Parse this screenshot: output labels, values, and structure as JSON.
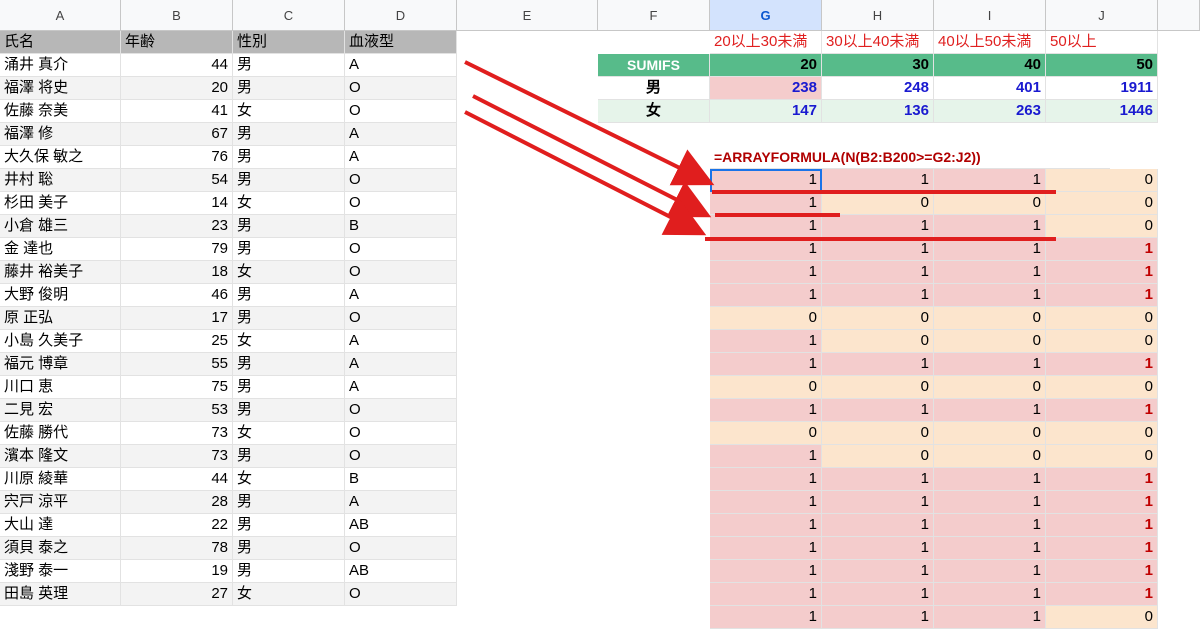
{
  "columns": [
    "A",
    "B",
    "C",
    "D",
    "E",
    "F",
    "G",
    "H",
    "I",
    "J"
  ],
  "selected_column": "G",
  "table_headers": {
    "name": "氏名",
    "age": "年齢",
    "gender": "性別",
    "blood": "血液型"
  },
  "people": [
    {
      "name": "涌井 真介",
      "age": "44",
      "gender": "男",
      "blood": "A"
    },
    {
      "name": "福澤 将史",
      "age": "20",
      "gender": "男",
      "blood": "O"
    },
    {
      "name": "佐藤 奈美",
      "age": "41",
      "gender": "女",
      "blood": "O"
    },
    {
      "name": "福澤 修",
      "age": "67",
      "gender": "男",
      "blood": "A"
    },
    {
      "name": "大久保 敏之",
      "age": "76",
      "gender": "男",
      "blood": "A"
    },
    {
      "name": "井村 聡",
      "age": "54",
      "gender": "男",
      "blood": "O"
    },
    {
      "name": "杉田 美子",
      "age": "14",
      "gender": "女",
      "blood": "O"
    },
    {
      "name": "小倉 雄三",
      "age": "23",
      "gender": "男",
      "blood": "B"
    },
    {
      "name": "金 達也",
      "age": "79",
      "gender": "男",
      "blood": "O"
    },
    {
      "name": "藤井 裕美子",
      "age": "18",
      "gender": "女",
      "blood": "O"
    },
    {
      "name": "大野 俊明",
      "age": "46",
      "gender": "男",
      "blood": "A"
    },
    {
      "name": "原 正弘",
      "age": "17",
      "gender": "男",
      "blood": "O"
    },
    {
      "name": "小島 久美子",
      "age": "25",
      "gender": "女",
      "blood": "A"
    },
    {
      "name": "福元 博章",
      "age": "55",
      "gender": "男",
      "blood": "A"
    },
    {
      "name": "川口 恵",
      "age": "75",
      "gender": "男",
      "blood": "A"
    },
    {
      "name": "二見 宏",
      "age": "53",
      "gender": "男",
      "blood": "O"
    },
    {
      "name": "佐藤 勝代",
      "age": "73",
      "gender": "女",
      "blood": "O"
    },
    {
      "name": "濱本 隆文",
      "age": "73",
      "gender": "男",
      "blood": "O"
    },
    {
      "name": "川原 綾華",
      "age": "44",
      "gender": "女",
      "blood": "B"
    },
    {
      "name": "宍戸 涼平",
      "age": "28",
      "gender": "男",
      "blood": "A"
    },
    {
      "name": "大山 達",
      "age": "22",
      "gender": "男",
      "blood": "AB"
    },
    {
      "name": "須貝 泰之",
      "age": "78",
      "gender": "男",
      "blood": "O"
    },
    {
      "name": "淺野 泰一",
      "age": "19",
      "gender": "男",
      "blood": "AB"
    },
    {
      "name": "田島 英理",
      "age": "27",
      "gender": "女",
      "blood": "O"
    }
  ],
  "range_labels": [
    "20以上30未満",
    "30以上40未満",
    "40以上50未満",
    "50以上"
  ],
  "sumifs": {
    "label": "SUMIFS",
    "thresholds": [
      "20",
      "30",
      "40",
      "50"
    ],
    "male_label": "男",
    "male": [
      "238",
      "248",
      "401",
      "1911"
    ],
    "female_label": "女",
    "female": [
      "147",
      "136",
      "263",
      "1446"
    ]
  },
  "formula": "=ARRAYFORMULA(N(B2:B200>=G2:J2))",
  "flags": [
    [
      "1",
      "1",
      "1",
      "0"
    ],
    [
      "1",
      "0",
      "0",
      "0"
    ],
    [
      "1",
      "1",
      "1",
      "0"
    ],
    [
      "1",
      "1",
      "1",
      "1"
    ],
    [
      "1",
      "1",
      "1",
      "1"
    ],
    [
      "1",
      "1",
      "1",
      "1"
    ],
    [
      "0",
      "0",
      "0",
      "0"
    ],
    [
      "1",
      "0",
      "0",
      "0"
    ],
    [
      "1",
      "1",
      "1",
      "1"
    ],
    [
      "0",
      "0",
      "0",
      "0"
    ],
    [
      "1",
      "1",
      "1",
      "1"
    ],
    [
      "0",
      "0",
      "0",
      "0"
    ],
    [
      "1",
      "0",
      "0",
      "0"
    ],
    [
      "1",
      "1",
      "1",
      "1"
    ],
    [
      "1",
      "1",
      "1",
      "1"
    ],
    [
      "1",
      "1",
      "1",
      "1"
    ],
    [
      "1",
      "1",
      "1",
      "1"
    ],
    [
      "1",
      "1",
      "1",
      "1"
    ],
    [
      "1",
      "1",
      "1",
      "1"
    ],
    [
      "1",
      "1",
      "1",
      "0"
    ]
  ],
  "colors": {
    "header_gray": "#b7b7b7",
    "sumifs_green": "#57bb8a",
    "pink": "#f4cccc",
    "peach": "#fce5cd",
    "arrow_red": "#e01e1e"
  }
}
